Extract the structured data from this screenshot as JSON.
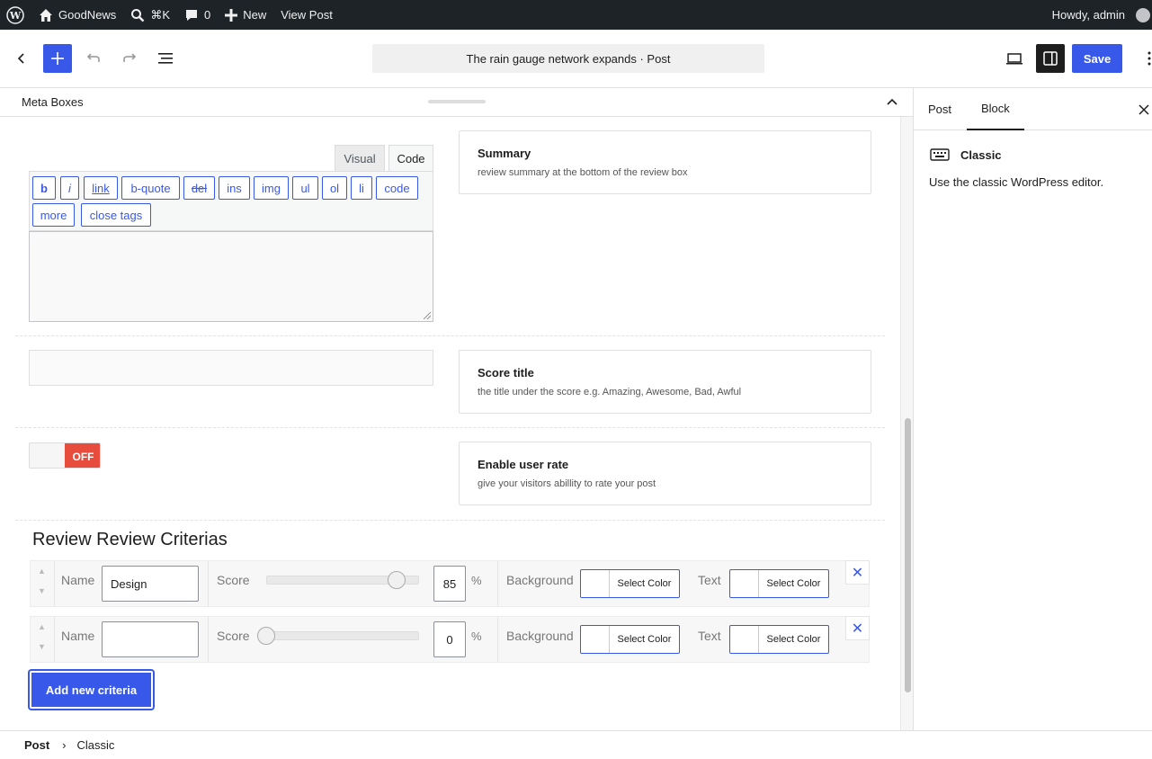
{
  "adminbar": {
    "site_name": "GoodNews",
    "search_shortcut": "⌘K",
    "comments_count": "0",
    "new_label": "New",
    "view_post_label": "View Post",
    "greeting": "Howdy, admin"
  },
  "header": {
    "document_title": "The rain gauge network expands · Post",
    "save_label": "Save"
  },
  "metaboxes": {
    "title": "Meta Boxes",
    "summary": {
      "tab_visual": "Visual",
      "tab_code": "Code",
      "quicktags": [
        "b",
        "i",
        "link",
        "b-quote",
        "del",
        "ins",
        "img",
        "ul",
        "ol",
        "li",
        "code",
        "more",
        "close tags"
      ],
      "textarea_value": "",
      "title": "Summary",
      "description": "review summary at the bottom of the review box"
    },
    "score_title": {
      "input_value": "",
      "title": "Score title",
      "description": "the title under the score e.g. Amazing, Awesome, Bad, Awful"
    },
    "user_rate": {
      "toggle_state": "OFF",
      "title": "Enable user rate",
      "description": "give your visitors abillity to rate your post"
    },
    "criteria": {
      "title": "Review Review Criterias",
      "name_label": "Name",
      "score_label": "Score",
      "percent_sign": "%",
      "background_label": "Background",
      "text_label": "Text",
      "select_color_label": "Select Color",
      "rows": [
        {
          "name": "Design",
          "score": "85",
          "score_fraction": 0.85
        },
        {
          "name": "",
          "score": "0",
          "score_fraction": 0
        }
      ],
      "add_button": "Add new criteria"
    }
  },
  "sidebar": {
    "tab_post": "Post",
    "tab_block": "Block",
    "block_name": "Classic",
    "block_description": "Use the classic WordPress editor."
  },
  "breadcrumb": {
    "root": "Post",
    "separator": "›",
    "current": "Classic"
  },
  "colors": {
    "accent": "#3858e9",
    "adminbar_bg": "#1d2327",
    "toggle_off": "#e74c3c"
  }
}
